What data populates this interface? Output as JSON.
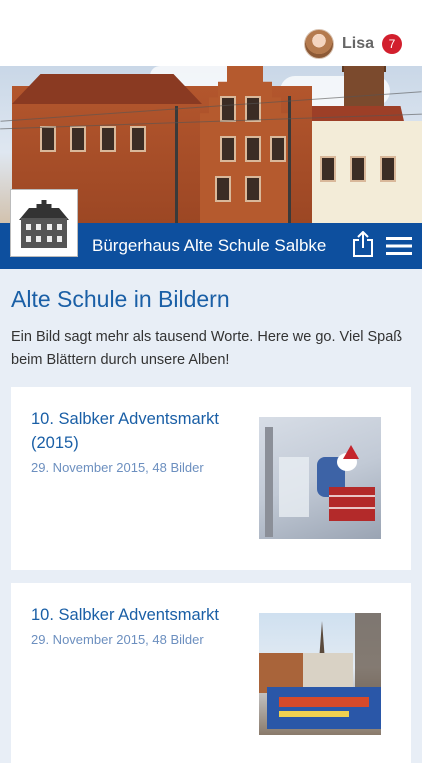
{
  "user": {
    "name": "Lisa",
    "notifications": "7"
  },
  "header": {
    "site_title": "Bürgerhaus Alte Schule Salbke"
  },
  "main": {
    "title": "Alte Schule in Bildern",
    "intro": "Ein Bild sagt mehr als tausend Worte. Here we go. Viel Spaß beim Blättern durch unsere Alben!"
  },
  "albums": [
    {
      "title": "10. Salbker Adventsmarkt (2015)",
      "meta": "29. November 2015, 48 Bilder"
    },
    {
      "title": "10. Salbker Adventsmarkt",
      "meta": "29. November 2015, 48 Bilder"
    }
  ],
  "colors": {
    "brand_blue": "#0d4f9e",
    "link_blue": "#1a5fa6",
    "badge_red": "#d21f2d",
    "page_bg": "#e8eef6"
  },
  "icons": {
    "share": "share-icon",
    "menu": "hamburger-menu-icon"
  }
}
